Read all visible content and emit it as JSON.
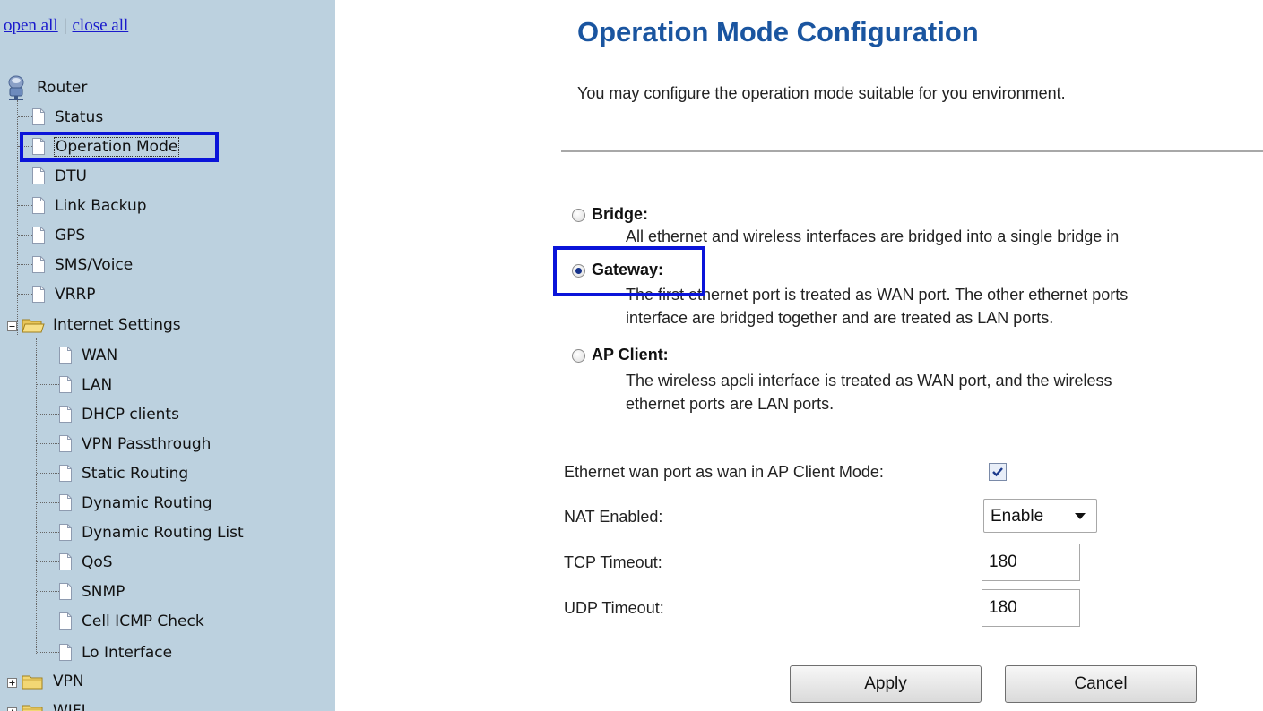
{
  "sidebar": {
    "open_all": "open all",
    "separator": "|",
    "close_all": "close all",
    "root": "Router",
    "items": [
      {
        "label": "Status"
      },
      {
        "label": "Operation Mode",
        "selected": true
      },
      {
        "label": "DTU"
      },
      {
        "label": "Link Backup"
      },
      {
        "label": "GPS"
      },
      {
        "label": "SMS/Voice"
      },
      {
        "label": "VRRP"
      }
    ],
    "internet_settings": {
      "label": "Internet Settings",
      "expanded": true,
      "children": [
        "WAN",
        "LAN",
        "DHCP clients",
        "VPN Passthrough",
        "Static Routing",
        "Dynamic Routing",
        "Dynamic Routing List",
        "QoS",
        "SNMP",
        "Cell ICMP Check",
        "Lo Interface"
      ]
    },
    "vpn": {
      "label": "VPN",
      "expanded": false
    },
    "wifi": {
      "label": "WIFI",
      "expanded": false
    }
  },
  "main": {
    "title": "Operation Mode Configuration",
    "description": "You may configure the operation mode suitable for you environment.",
    "modes": [
      {
        "label": "Bridge:",
        "checked": false,
        "desc": [
          "All ethernet and wireless interfaces are bridged into a single bridge in"
        ]
      },
      {
        "label": "Gateway:",
        "checked": true,
        "desc": [
          "The first ethernet port is treated as WAN port. The other ethernet ports",
          "interface are bridged together and are treated as LAN ports."
        ]
      },
      {
        "label": "AP Client:",
        "checked": false,
        "desc": [
          "The wireless apcli interface is treated as WAN port, and the wireless",
          "ethernet ports are LAN ports."
        ]
      }
    ],
    "form": {
      "eth_wan_label": "Ethernet wan port as wan in AP Client Mode:",
      "eth_wan_checked": true,
      "nat_label": "NAT Enabled:",
      "nat_value": "Enable",
      "tcp_label": "TCP Timeout:",
      "tcp_value": "180",
      "udp_label": "UDP Timeout:",
      "udp_value": "180"
    },
    "buttons": {
      "apply": "Apply",
      "cancel": "Cancel"
    }
  },
  "colors": {
    "sidebar_bg": "#bcd1df",
    "title": "#1a55a0",
    "highlight_box": "#0a14d9",
    "link": "#1a1acc"
  },
  "icons": {
    "tree_page": "document-icon",
    "tree_folder": "folder-icon",
    "tree_root": "router-icon"
  }
}
